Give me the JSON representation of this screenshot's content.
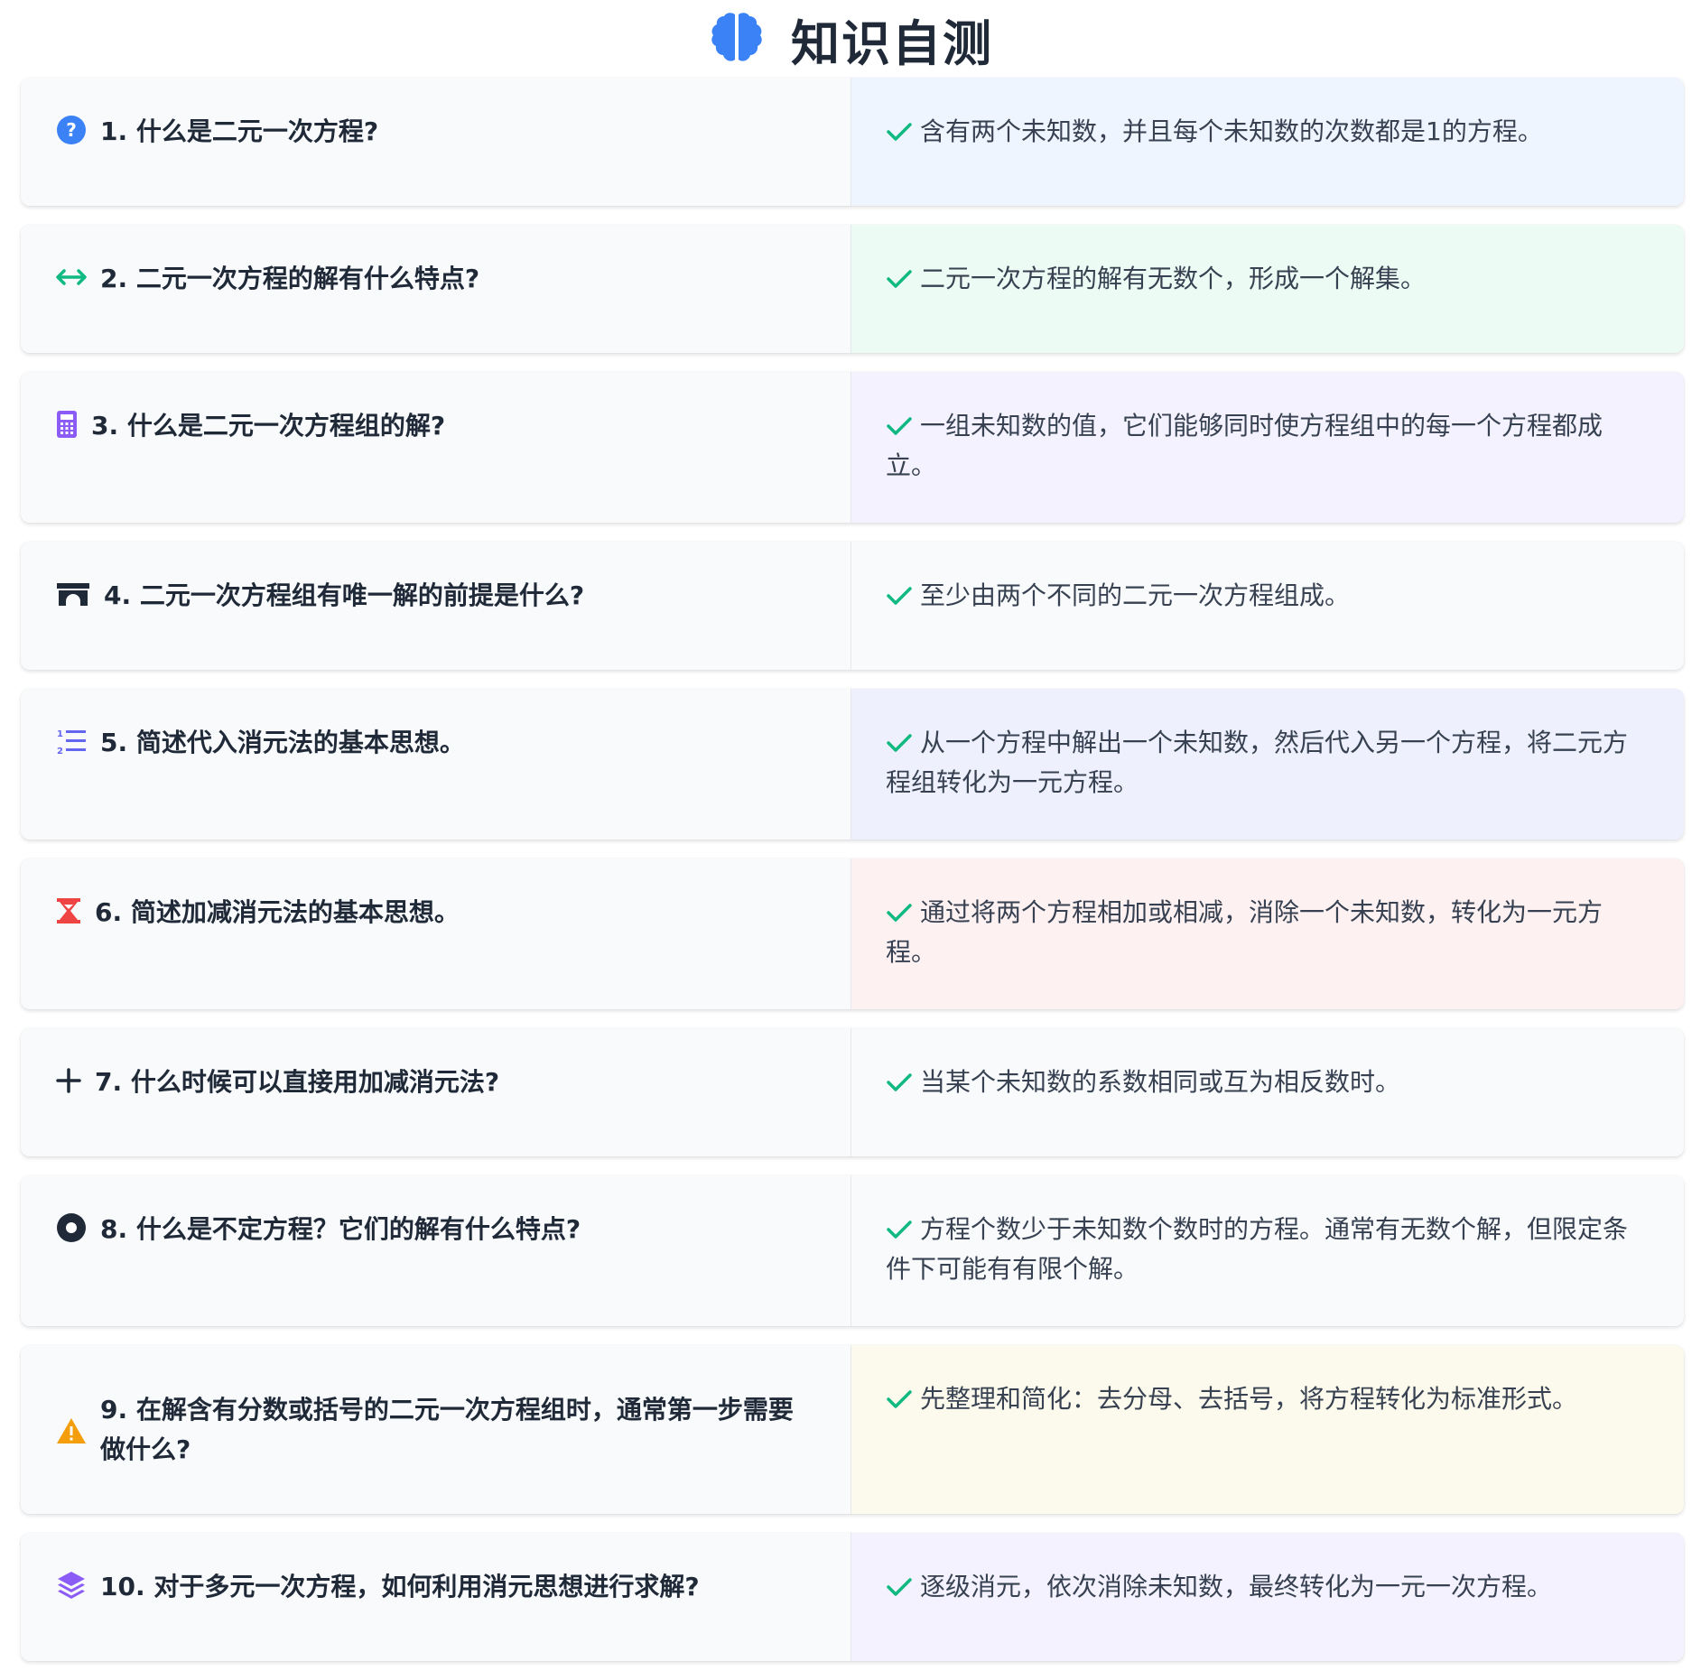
{
  "header": {
    "title": "知识自测",
    "icon": "brain-icon",
    "icon_color": "#3b82f6"
  },
  "cards": [
    {
      "question": "1. 什么是二元一次方程?",
      "answer": "含有两个未知数，并且每个未知数的次数都是1的方程。",
      "icon": "question-circle-icon",
      "icon_color": "#3b82f6",
      "answer_bg": "#eef5fe"
    },
    {
      "question": "2. 二元一次方程的解有什么特点?",
      "answer": "二元一次方程的解有无数个，形成一个解集。",
      "icon": "arrows-left-right-icon",
      "icon_color": "#10b981",
      "answer_bg": "#ecfbf3"
    },
    {
      "question": "3. 什么是二元一次方程组的解?",
      "answer": "一组未知数的值，它们能够同时使方程组中的每一个方程都成立。",
      "icon": "calculator-icon",
      "icon_color": "#8b5cf6",
      "answer_bg": "#f3f2fe"
    },
    {
      "question": "4. 二元一次方程组有唯一解的前提是什么?",
      "answer": "至少由两个不同的二元一次方程组成。",
      "icon": "archway-icon",
      "icon_color": "#1f2937",
      "answer_bg": "#f8fafc"
    },
    {
      "question": "5. 简述代入消元法的基本思想。",
      "answer": "从一个方程中解出一个未知数，然后代入另一个方程，将二元方程组转化为一元方程。",
      "icon": "list-ol-icon",
      "icon_color": "#6366f1",
      "answer_bg": "#eef1fd"
    },
    {
      "question": "6. 简述加减消元法的基本思想。",
      "answer": "通过将两个方程相加或相减，消除一个未知数，转化为一元方程。",
      "icon": "hourglass-icon",
      "icon_color": "#ef4444",
      "answer_bg": "#fdf1f1"
    },
    {
      "question": "7. 什么时候可以直接用加减消元法?",
      "answer": "当某个未知数的系数相同或互为相反数时。",
      "icon": "plus-icon",
      "icon_color": "#1f2937",
      "answer_bg": "#f8fafc"
    },
    {
      "question": "8. 什么是不定方程？它们的解有什么特点?",
      "answer": "方程个数少于未知数个数时的方程。通常有无数个解，但限定条件下可能有有限个解。",
      "icon": "dot-circle-icon",
      "icon_color": "#1f2937",
      "answer_bg": "#f8fafc"
    },
    {
      "question": "9. 在解含有分数或括号的二元一次方程组时，通常第一步需要做什么?",
      "answer": "先整理和简化：去分母、去括号，将方程转化为标准形式。",
      "icon": "warning-triangle-icon",
      "icon_color": "#f59e0b",
      "answer_bg": "#fcfaec"
    },
    {
      "question": "10. 对于多元一次方程，如何利用消元思想进行求解?",
      "answer": "逐级消元，依次消除未知数，最终转化为一元一次方程。",
      "icon": "layers-icon",
      "icon_color": "#8b5cf6",
      "answer_bg": "#f3f2fe"
    }
  ],
  "check_icon": "check-icon",
  "check_color": "#10b981"
}
